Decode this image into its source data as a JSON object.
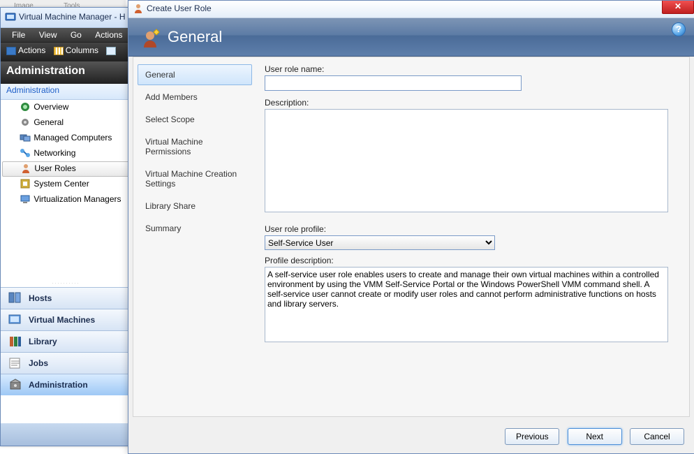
{
  "top_menu": {
    "left": "Image",
    "right": "Tools"
  },
  "vmm": {
    "title": "Virtual Machine Manager - H",
    "menubar": [
      "File",
      "View",
      "Go",
      "Actions"
    ],
    "toolbar": {
      "actions": "Actions",
      "columns": "Columns"
    },
    "admin_header": "Administration",
    "admin_sub": "Administration",
    "tree": [
      {
        "id": "overview",
        "label": "Overview"
      },
      {
        "id": "general",
        "label": "General"
      },
      {
        "id": "managed-computers",
        "label": "Managed Computers"
      },
      {
        "id": "networking",
        "label": "Networking"
      },
      {
        "id": "user-roles",
        "label": "User Roles",
        "selected": true
      },
      {
        "id": "system-center",
        "label": "System Center"
      },
      {
        "id": "virtualization-managers",
        "label": "Virtualization Managers"
      }
    ],
    "nav": [
      {
        "id": "hosts",
        "label": "Hosts"
      },
      {
        "id": "virtual-machines",
        "label": "Virtual Machines"
      },
      {
        "id": "library",
        "label": "Library"
      },
      {
        "id": "jobs",
        "label": "Jobs"
      },
      {
        "id": "administration",
        "label": "Administration",
        "active": true
      }
    ]
  },
  "dialog": {
    "title": "Create User Role",
    "close": "✕",
    "header_title": "General",
    "help": "?",
    "steps": [
      "General",
      "Add Members",
      "Select Scope",
      "Virtual Machine Permissions",
      "Virtual Machine Creation Settings",
      "Library Share",
      "Summary"
    ],
    "form": {
      "name_label": "User role name:",
      "name_value": "",
      "desc_label": "Description:",
      "desc_value": "",
      "profile_label": "User role profile:",
      "profile_selected": "Self-Service User",
      "profile_desc_label": "Profile description:",
      "profile_desc_value": "A self-service user role enables users to create and manage their own virtual machines within a controlled environment by using the VMM Self-Service Portal or the Windows PowerShell VMM command shell. A self-service user cannot create or modify user roles and cannot perform administrative functions on hosts and library servers."
    },
    "buttons": {
      "previous": "Previous",
      "next": "Next",
      "cancel": "Cancel"
    }
  }
}
